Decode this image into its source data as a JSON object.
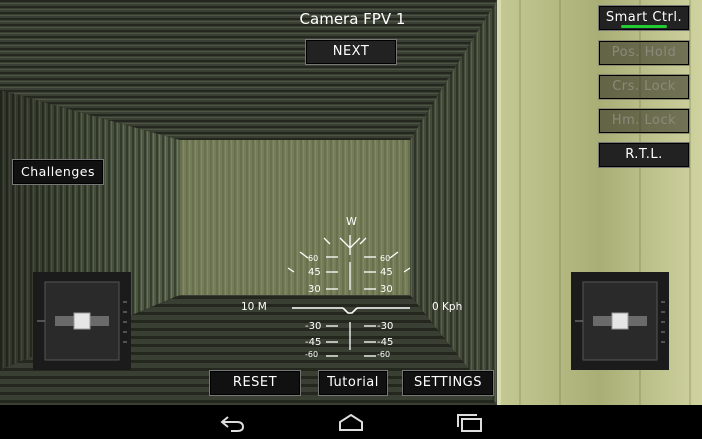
{
  "header": {
    "title": "Camera FPV 1",
    "next_label": "NEXT"
  },
  "left_panel": {
    "challenges_label": "Challenges"
  },
  "right_panel": {
    "smart_ctrl_label": "Smart Ctrl.",
    "pos_hold_label": "Pos. Hold",
    "crs_lock_label": "Crs. Lock",
    "hm_lock_label": "Hm. Lock",
    "rtl_label": "R.T.L."
  },
  "hud": {
    "heading_label": "W",
    "altitude_label": "10 M",
    "speed_label": "0 Kph",
    "pitch_up": [
      "60",
      "45",
      "30"
    ],
    "pitch_down": [
      "-30",
      "-45",
      "-60"
    ]
  },
  "bottom_bar": {
    "reset_label": "RESET",
    "tutorial_label": "Tutorial",
    "settings_label": "SETTINGS"
  },
  "nav": {
    "back_icon": "back-icon",
    "home_icon": "home-icon",
    "recents_icon": "recents-icon"
  },
  "colors": {
    "accent_green": "#22cc33",
    "wall_yellow": "#b7bd86"
  }
}
